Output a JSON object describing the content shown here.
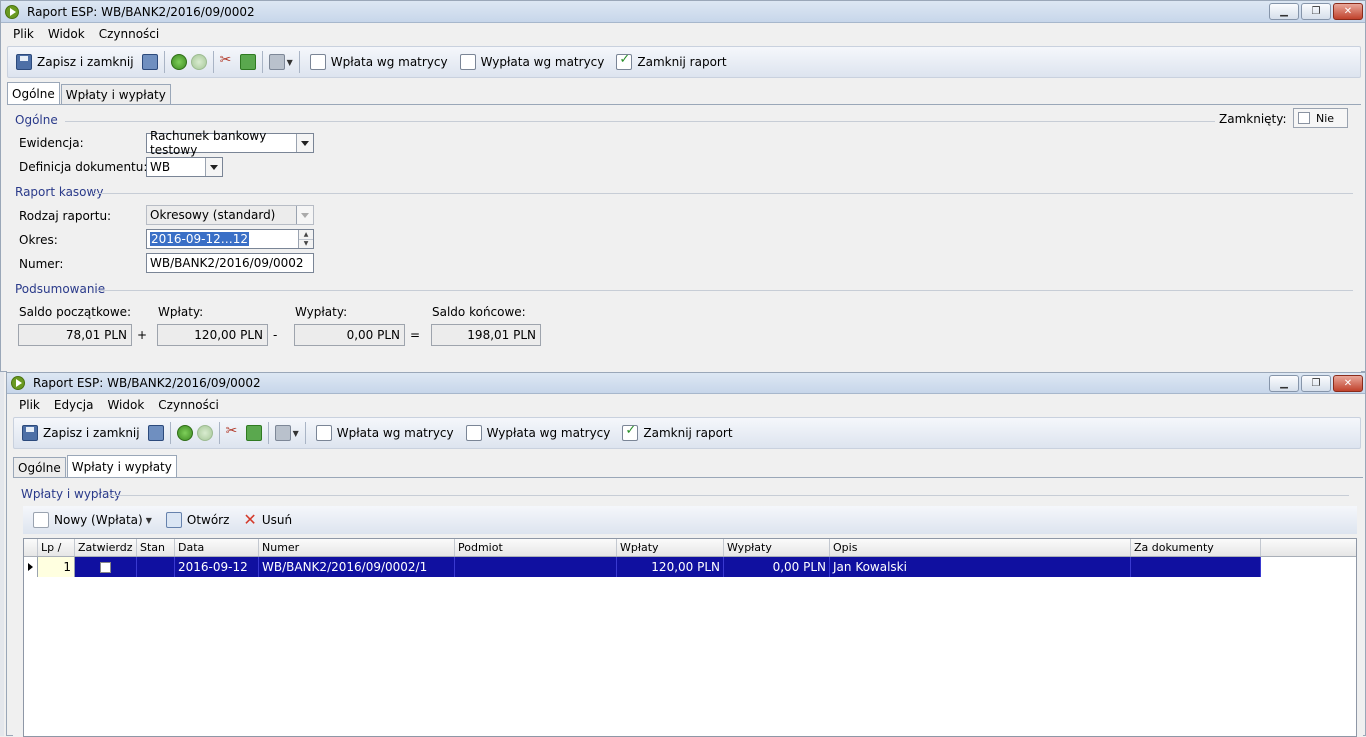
{
  "window1": {
    "title": "Raport ESP: WB/BANK2/2016/09/0002",
    "menu": [
      "Plik",
      "Widok",
      "Czynności"
    ],
    "toolbar": {
      "save_close": "Zapisz i zamknij",
      "wplata": "Wpłata wg matrycy",
      "wyplata": "Wypłata wg matrycy",
      "zamknij": "Zamknij raport"
    },
    "tabs": [
      "Ogólne",
      "Wpłaty i wypłaty"
    ],
    "ogolne": {
      "section_title": "Ogólne",
      "zamkniety_label": "Zamknięty:",
      "zamkniety_value": "Nie",
      "ewidencja_label": "Ewidencja:",
      "ewidencja_value": "Rachunek bankowy testowy",
      "definicja_label": "Definicja dokumentu:",
      "definicja_value": "WB"
    },
    "raport": {
      "section_title": "Raport kasowy",
      "rodzaj_label": "Rodzaj raportu:",
      "rodzaj_value": "Okresowy (standard)",
      "okres_label": "Okres:",
      "okres_value": "2016-09-12…12",
      "numer_label": "Numer:",
      "numer_value": "WB/BANK2/2016/09/0002"
    },
    "podsumowanie": {
      "section_title": "Podsumowanie",
      "saldo_pocz_label": "Saldo początkowe:",
      "saldo_pocz_value": "78,01 PLN",
      "wplaty_label": "Wpłaty:",
      "wplaty_value": "120,00 PLN",
      "wyplaty_label": "Wypłaty:",
      "wyplaty_value": "0,00 PLN",
      "saldo_konc_label": "Saldo końcowe:",
      "saldo_konc_value": "198,01 PLN",
      "op_plus": "+",
      "op_minus": "-",
      "op_eq": "="
    }
  },
  "window2": {
    "title": "Raport ESP: WB/BANK2/2016/09/0002",
    "menu": [
      "Plik",
      "Edycja",
      "Widok",
      "Czynności"
    ],
    "toolbar": {
      "save_close": "Zapisz i zamknij",
      "wplata": "Wpłata wg matrycy",
      "wyplata": "Wypłata wg matrycy",
      "zamknij": "Zamknij raport"
    },
    "tabs": [
      "Ogólne",
      "Wpłaty i wypłaty"
    ],
    "section_title": "Wpłaty i wypłaty",
    "grid_toolbar": {
      "nowy": "Nowy (Wpłata)",
      "otworz": "Otwórz",
      "usun": "Usuń"
    },
    "columns": [
      "Lp /",
      "Zatwierdz",
      "Stan",
      "Data",
      "Numer",
      "Podmiot",
      "Wpłaty",
      "Wypłaty",
      "Opis",
      "Za dokumenty"
    ],
    "rows": [
      {
        "lp": "1",
        "stan": "",
        "data": "2016-09-12",
        "numer": "WB/BANK2/2016/09/0002/1",
        "podmiot": "",
        "wplaty": "120,00 PLN",
        "wyplaty": "0,00 PLN",
        "opis": "Jan Kowalski",
        "za_dokumenty": ""
      }
    ]
  }
}
